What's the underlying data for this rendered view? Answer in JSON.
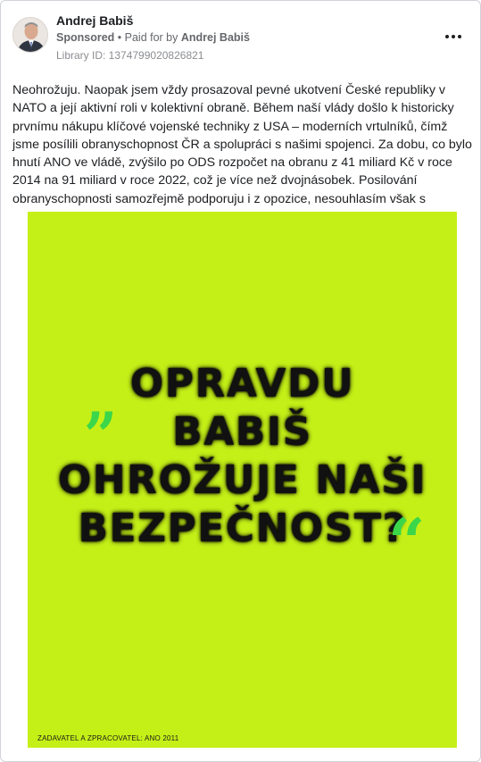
{
  "post": {
    "page_name": "Andrej Babiš",
    "sponsored_label": "Sponsored",
    "separator": " • ",
    "paid_for_prefix": "Paid for by ",
    "paid_for_name": "Andrej Babiš",
    "library_id": "Library ID: 1374799020826821",
    "more_icon": "more-horizontal-icon",
    "body_text": "Neohrožuju. Naopak jsem vždy prosazoval pevné ukotvení České republiky v NATO a její aktivní roli v kolektivní obraně. Během naší vlády došlo k historicky prvnímu nákupu klíčové vojenské techniky z USA – moderních vrtulníků, čímž jsme posílili obranyschopnost ČR a spolupráci s našimi spojenci. Za dobu, co bylo hnutí ANO ve vládě, zvýšilo po ODS rozpočet na obranu z 41 miliard Kč v roce 2014 na 91 miliard v roce 2022, což je více než dvojnásobek. Posilování obranyschopnosti samozřejmě podporuju i z opozice, nesouhlasím však s netransparentními a…"
  },
  "creative": {
    "background_color": "#c5f017",
    "quote_color": "#3bd64a",
    "quote_open": "„",
    "quote_close": "“",
    "headline_lines": [
      "OPRAVDU",
      "BABIŠ",
      "OHROŽUJE NAŠI",
      "BEZPEČNOST?"
    ],
    "disclaimer": "ZADAVATEL A ZPRACOVATEL: ANO 2011"
  }
}
